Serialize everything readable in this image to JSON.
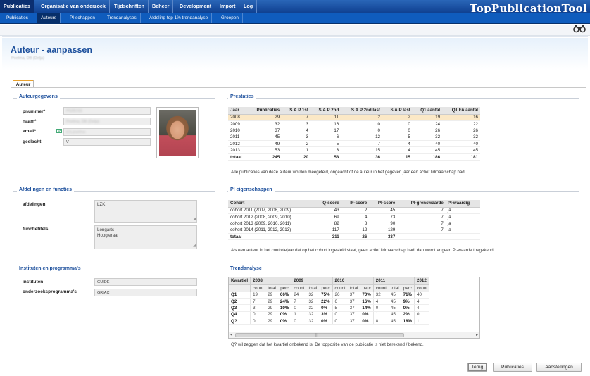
{
  "app": {
    "title": "TopPublicationTool"
  },
  "menu": [
    {
      "label": "Publicaties",
      "active": true
    },
    {
      "label": "Organisatie van onderzoek"
    },
    {
      "label": "Tijdschriften"
    },
    {
      "label": "Beheer"
    },
    {
      "label": "Development"
    },
    {
      "label": "Import"
    },
    {
      "label": "Log"
    }
  ],
  "submenu": [
    {
      "label": "Publicaties"
    },
    {
      "label": "Auteurs",
      "active": true
    },
    {
      "label": "PI-schappen"
    },
    {
      "label": "Trendanalyses"
    },
    {
      "label": "Afdeling top 1% trendanalyse"
    },
    {
      "label": "Groepen"
    }
  ],
  "page": {
    "title": "Auteur - aanpassen",
    "subtitle": "Poelma, DB (Delja)"
  },
  "tab": {
    "label": "Auteur"
  },
  "auteurgegevens": {
    "title": "Auteurgegevens",
    "pnummer_label": "pnummer*",
    "pnummer_value": "P0281S5",
    "naam_label": "naam*",
    "naam_value": "Poelma, DB (Delja)",
    "email_label": "email*",
    "email_value": "d.b.poelma",
    "geslacht_label": "geslacht",
    "geslacht_value": "V"
  },
  "prestaties": {
    "title": "Prestaties",
    "headers": [
      "Jaar",
      "Publicaties",
      "S.A.P 1st",
      "S.A.P 2nd",
      "S.A.P 2nd last",
      "S.A.P last",
      "Q1 aantal",
      "Q1 FA aantal"
    ],
    "rows": [
      [
        "2008",
        "29",
        "7",
        "11",
        "2",
        "2",
        "19",
        "16"
      ],
      [
        "2009",
        "32",
        "3",
        "16",
        "0",
        "0",
        "24",
        "22"
      ],
      [
        "2010",
        "37",
        "4",
        "17",
        "0",
        "0",
        "26",
        "26"
      ],
      [
        "2011",
        "45",
        "3",
        "6",
        "12",
        "5",
        "32",
        "32"
      ],
      [
        "2012",
        "49",
        "2",
        "5",
        "7",
        "4",
        "40",
        "40"
      ],
      [
        "2013",
        "53",
        "1",
        "3",
        "15",
        "4",
        "45",
        "45"
      ]
    ],
    "total": [
      "totaal",
      "245",
      "20",
      "58",
      "36",
      "15",
      "186",
      "181"
    ],
    "note": "Alle publicaties van deze auteur worden meegeteld, ongeacht of de auteur in het gegeven jaar een actief lidmaatschap had."
  },
  "afdelingen": {
    "title": "Afdelingen en functies",
    "afdelingen_label": "afdelingen",
    "afdelingen_value": "LZK",
    "functietitels_label": "functietitels",
    "functietitels_line1": "Longarts",
    "functietitels_line2": "Hoogleraar"
  },
  "pi": {
    "title": "PI eigenschappen",
    "headers": [
      "Cohort",
      "Q-score",
      "IF-score",
      "PI-score",
      "PI-grenswaarde",
      "PI-waardig"
    ],
    "rows": [
      [
        "cohort 2011 (2007, 2008, 2009)",
        "43",
        "2",
        "45",
        "7",
        "ja"
      ],
      [
        "cohort 2012 (2008, 2009, 2010)",
        "69",
        "4",
        "73",
        "7",
        "ja"
      ],
      [
        "cohort 2013 (2009, 2010, 2011)",
        "82",
        "8",
        "90",
        "7",
        "ja"
      ],
      [
        "cohort 2014 (2011, 2012, 2013)",
        "117",
        "12",
        "129",
        "7",
        "ja"
      ]
    ],
    "total": [
      "totaal",
      "311",
      "26",
      "337",
      "",
      ""
    ],
    "note": "Als een auteur in het controlejaar dat op het cohort ingesteld staat, geen actief lidmaatschap had, dan wordt er geen PI-waarde toegekend."
  },
  "instituten": {
    "title": "Instituten en programma's",
    "instituten_label": "instituten",
    "instituten_value": "GUIDE",
    "programma_label": "onderzoeksprogramma's",
    "programma_value": "GRIAC"
  },
  "trend": {
    "title": "Trendanalyse",
    "corner": "Kwartiel",
    "years": [
      "2008",
      "2009",
      "2010",
      "2011",
      "2012"
    ],
    "subheaders": [
      "count",
      "total",
      "perc"
    ],
    "rows": [
      {
        "k": "Q1",
        "v": [
          "19",
          "29",
          "66%",
          "24",
          "32",
          "75%",
          "26",
          "37",
          "70%",
          "32",
          "45",
          "71%",
          "40"
        ]
      },
      {
        "k": "Q2",
        "v": [
          "7",
          "29",
          "24%",
          "7",
          "32",
          "22%",
          "6",
          "37",
          "16%",
          "4",
          "45",
          "9%",
          "4"
        ]
      },
      {
        "k": "Q3",
        "v": [
          "3",
          "29",
          "10%",
          "0",
          "32",
          "0%",
          "5",
          "37",
          "14%",
          "0",
          "45",
          "0%",
          "4"
        ]
      },
      {
        "k": "Q4",
        "v": [
          "0",
          "29",
          "0%",
          "1",
          "32",
          "3%",
          "0",
          "37",
          "0%",
          "1",
          "45",
          "2%",
          "0"
        ]
      },
      {
        "k": "Q?",
        "v": [
          "0",
          "29",
          "0%",
          "0",
          "32",
          "0%",
          "0",
          "37",
          "0%",
          "8",
          "45",
          "18%",
          "1"
        ]
      }
    ],
    "note": "Q? wil zeggen dat het kwartiel onbekend is. De toppositie van de publicatie is niet berekend / bekend."
  },
  "buttons": {
    "terug": "Terug",
    "publicaties": "Publicaties",
    "aanstellingen": "Aanstellingen"
  },
  "colors": {
    "accent": "#1c4f9c",
    "menu": "#0e3f8f",
    "highlight": "#fbe8c6",
    "tab_top": "#e9a12d"
  }
}
